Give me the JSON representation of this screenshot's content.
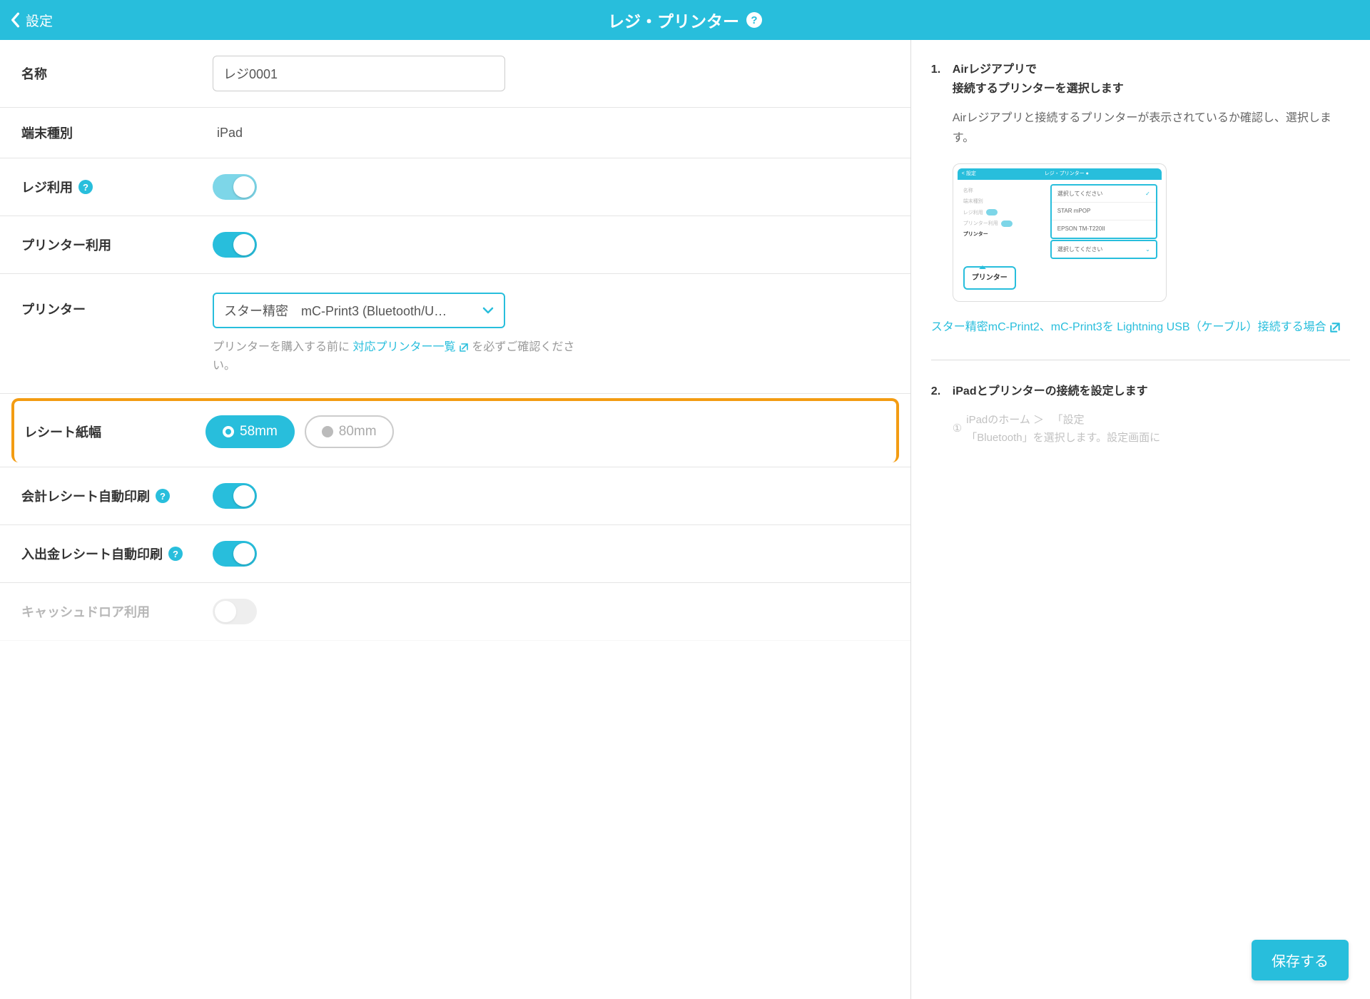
{
  "header": {
    "back": "設定",
    "title": "レジ・プリンター"
  },
  "rows": {
    "name": {
      "label": "名称",
      "value": "レジ0001"
    },
    "device": {
      "label": "端末種別",
      "value": "iPad"
    },
    "regi_use": {
      "label": "レジ利用"
    },
    "printer_use": {
      "label": "プリンター利用"
    },
    "printer": {
      "label": "プリンター",
      "value": "スター精密　mC-Print3 (Bluetooth/U…",
      "hint_pre": "プリンターを購入する前に ",
      "hint_link": "対応プリンター一覧",
      "hint_post": " を必ずご確認ください。"
    },
    "width": {
      "label": "レシート紙幅",
      "opt1": "58mm",
      "opt2": "80mm"
    },
    "auto1": {
      "label": "会計レシート自動印刷"
    },
    "auto2": {
      "label": "入出金レシート自動印刷"
    },
    "drawer": {
      "label": "キャッシュドロア利用"
    }
  },
  "side": {
    "s1_num": "1.",
    "s1_title": "Airレジアプリで\n接続するプリンターを選択します",
    "s1_body": "Airレジアプリと接続するプリンターが表示されているか確認し、選択します。",
    "illus": {
      "top_l": "< 設定",
      "top_c": "レジ・プリンター ●",
      "d1": "選択してください",
      "d2": "STAR mPOP",
      "d3": "EPSON TM-T220II",
      "d4": "選択してください",
      "tag": "プリンター",
      "side": [
        "名称",
        "端末種別",
        "レジ利用",
        "プリンター利用",
        "",
        "プリンター"
      ]
    },
    "link": "スター精密mC-Print2、mC-Print3を Lightning USB（ケーブル）接続する場合",
    "s2_num": "2.",
    "s2_title": "iPadとプリンターの接続を設定します",
    "s2_faded": "iPadのホーム ＞ 　「設定\n「Bluetooth」を選択します。設定画面に"
  },
  "save": "保存する"
}
